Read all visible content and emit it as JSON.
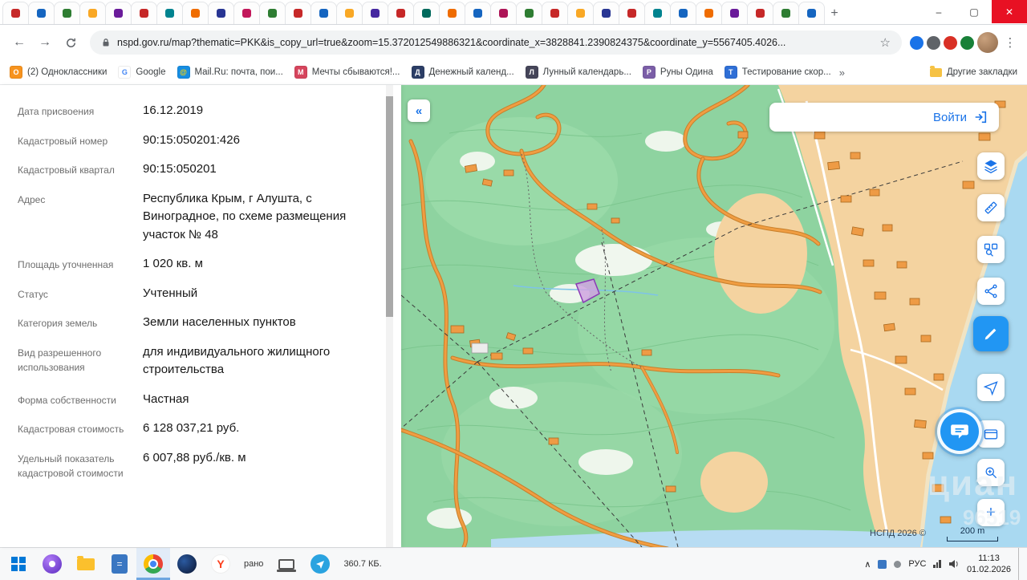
{
  "colors": {
    "accent": "#1a73e8",
    "active_control": "#2196f3",
    "close_button": "#e81123",
    "map_green": "#8ed3a0",
    "sea": "#a9d9f1",
    "urban": "#f4d3a0",
    "road": "#f09d42",
    "parcel_fill": "#cfa5e0",
    "parcel_stroke": "#8a3ab5"
  },
  "icons": {
    "back": "←",
    "forward": "→",
    "menu": "⋮",
    "star": "☆",
    "new_tab": "+",
    "min": "–",
    "max": "▢",
    "close": "✕",
    "collapse": "«",
    "plus": "+",
    "tray_chevron": "∧",
    "calc": "=",
    "yandex": "Y",
    "bm_more": "»"
  },
  "browser": {
    "url": "nspd.gov.ru/map?thematic=PKK&is_copy_url=true&zoom=15.372012549886321&coordinate_x=3828841.2390824375&coordinate_y=5567405.4026...",
    "tabs": [
      {
        "c": "#c62828"
      },
      {
        "c": "#1565c0"
      },
      {
        "c": "#2e7d32"
      },
      {
        "c": "#f9a825"
      },
      {
        "c": "#6a1b9a"
      },
      {
        "c": "#c62828"
      },
      {
        "c": "#00838f"
      },
      {
        "c": "#ef6c00"
      },
      {
        "c": "#283593"
      },
      {
        "c": "#c2185b"
      },
      {
        "c": "#2e7d32"
      },
      {
        "c": "#c62828"
      },
      {
        "c": "#1565c0"
      },
      {
        "c": "#f9a825"
      },
      {
        "c": "#4527a0"
      },
      {
        "c": "#c62828"
      },
      {
        "c": "#00695c"
      },
      {
        "c": "#ef6c00"
      },
      {
        "c": "#1565c0"
      },
      {
        "c": "#ad1457"
      },
      {
        "c": "#2e7d32"
      },
      {
        "c": "#c62828"
      },
      {
        "c": "#f9a825"
      },
      {
        "c": "#283593"
      },
      {
        "c": "#c62828"
      },
      {
        "c": "#00838f"
      },
      {
        "c": "#1565c0"
      },
      {
        "c": "#ef6c00"
      },
      {
        "c": "#6a1b9a"
      },
      {
        "c": "#c62828"
      },
      {
        "c": "#2e7d32"
      },
      {
        "c": "#1565c0"
      }
    ],
    "bookmarks": [
      {
        "label": "(2) Одноклассники",
        "bg": "#f7931e",
        "fg": "#ffffff",
        "glyph": "O"
      },
      {
        "label": "Google",
        "bg": "#ffffff",
        "fg": "#4285F4",
        "glyph": "G"
      },
      {
        "label": "Mail.Ru: почта, пои...",
        "bg": "#168de2",
        "fg": "#ffd500",
        "glyph": "@"
      },
      {
        "label": "Мечты сбываются!...",
        "bg": "#d6455d",
        "fg": "#ffffff",
        "glyph": "М"
      },
      {
        "label": "Денежный календ...",
        "bg": "#2c3e66",
        "fg": "#ffffff",
        "glyph": "Д"
      },
      {
        "label": "Лунный календарь...",
        "bg": "#454559",
        "fg": "#ffffff",
        "glyph": "Л"
      },
      {
        "label": "Руны Одина",
        "bg": "#7b5ea7",
        "fg": "#ffffff",
        "glyph": "Р"
      },
      {
        "label": "Тестирование скор...",
        "bg": "#2f6fd6",
        "fg": "#ffffff",
        "glyph": "Т"
      }
    ],
    "other_bookmarks": "Другие закладки"
  },
  "panel": {
    "fields": [
      {
        "label": "Дата присвоения",
        "value": "16.12.2019"
      },
      {
        "label": "Кадастровый номер",
        "value": "90:15:050201:426"
      },
      {
        "label": "Кадастровый квартал",
        "value": "90:15:050201"
      },
      {
        "label": "Адрес",
        "value": "Республика Крым, г Алушта, с Виноградное, по схеме размещения участок № 48"
      },
      {
        "label": "Площадь уточненная",
        "value": "1 020 кв. м"
      },
      {
        "label": "Статус",
        "value": "Учтенный"
      },
      {
        "label": "Категория земель",
        "value": "Земли населенных пунктов"
      },
      {
        "label": "Вид разрешенного использования",
        "value": "для индивидуального жилищного строительства"
      },
      {
        "label": "Форма собственности",
        "value": "Частная"
      },
      {
        "label": "Кадастровая стоимость",
        "value": "6 128 037,21 руб."
      },
      {
        "label": "Удельный показатель кадастровой стоимости",
        "value": "6 007,88 руб./кв. м"
      }
    ]
  },
  "map": {
    "login": "Войти",
    "scale": "200 m",
    "attribution": "НСПД 2026 ©",
    "watermark": "циан",
    "watermark_digits": "96519"
  },
  "taskbar": {
    "toast_left": "рано",
    "toast_right": "360.7 КБ.",
    "lang": "РУС",
    "time": "11:13",
    "date": "01.02.2026"
  }
}
